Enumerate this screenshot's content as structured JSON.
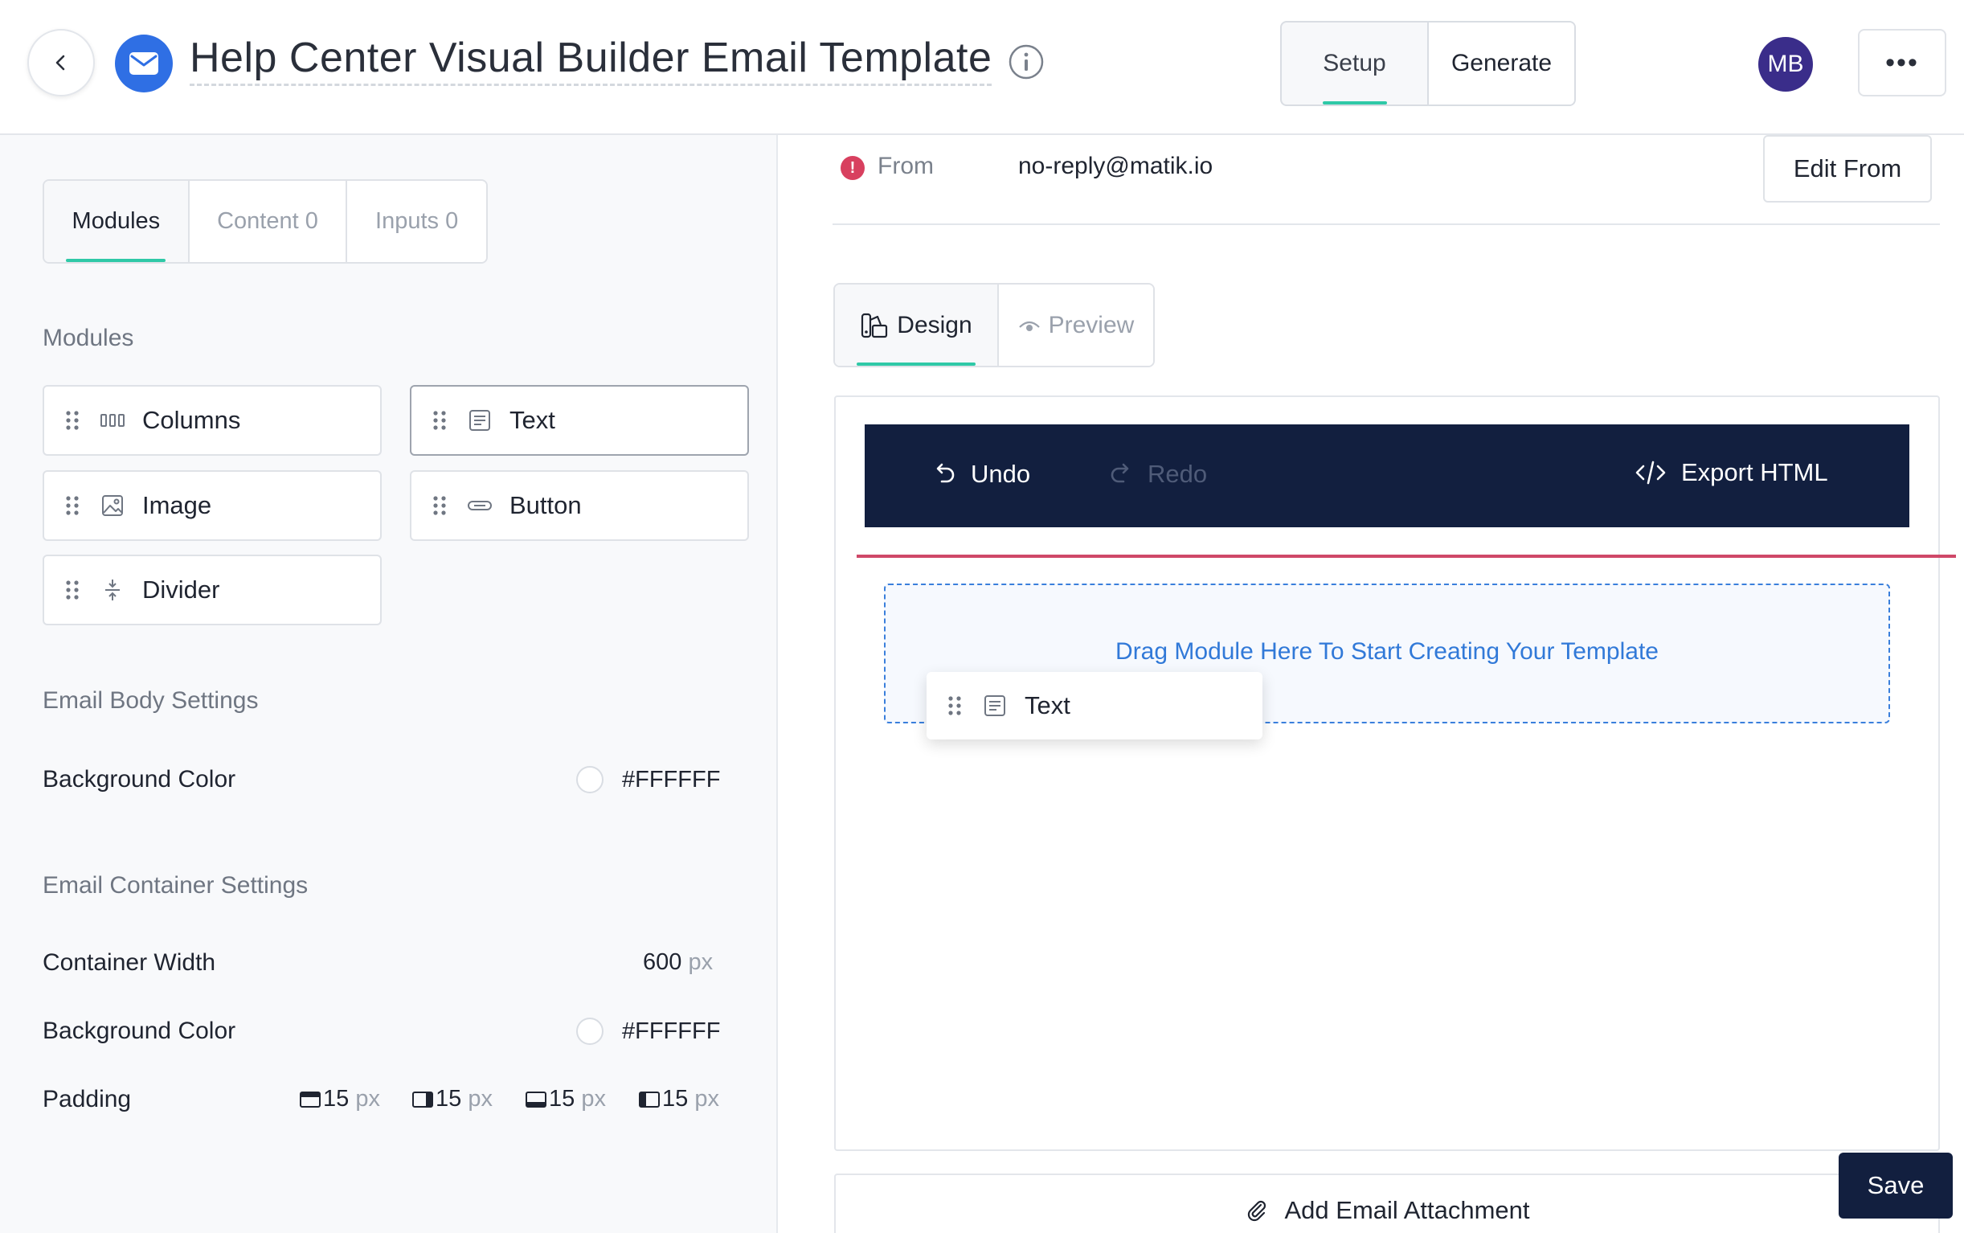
{
  "header": {
    "title": "Help Center Visual Builder Email Template",
    "setup_label": "Setup",
    "generate_label": "Generate",
    "avatar_initials": "MB",
    "more_label": "•••"
  },
  "left": {
    "tabs": [
      {
        "label": "Modules"
      },
      {
        "label": "Content 0"
      },
      {
        "label": "Inputs 0"
      }
    ],
    "modules_heading": "Modules",
    "modules": [
      {
        "label": "Columns",
        "icon": "columns-icon"
      },
      {
        "label": "Text",
        "icon": "text-icon"
      },
      {
        "label": "Image",
        "icon": "image-icon"
      },
      {
        "label": "Button",
        "icon": "button-icon"
      },
      {
        "label": "Divider",
        "icon": "divider-icon"
      }
    ],
    "email_body_heading": "Email Body Settings",
    "body_background_label": "Background Color",
    "body_background_value": "#FFFFFF",
    "email_container_heading": "Email Container Settings",
    "container_width_label": "Container Width",
    "container_width_value": "600",
    "unit_px": "px",
    "container_background_label": "Background Color",
    "container_background_value": "#FFFFFF",
    "padding_label": "Padding",
    "padding": [
      {
        "side": "top",
        "value": "15"
      },
      {
        "side": "right",
        "value": "15"
      },
      {
        "side": "bottom",
        "value": "15"
      },
      {
        "side": "left",
        "value": "15"
      }
    ]
  },
  "right": {
    "from_label": "From",
    "from_value": "no-reply@matik.io",
    "edit_from_label": "Edit From",
    "tabs": [
      {
        "label": "Design"
      },
      {
        "label": "Preview"
      }
    ],
    "undo_label": "Undo",
    "redo_label": "Redo",
    "export_label": "Export HTML",
    "drop_text": "Drag Module Here To Start Creating Your Template",
    "drag_ghost_label": "Text",
    "attach_label": "Add Email Attachment",
    "save_label": "Save"
  },
  "colors": {
    "accent": "#2fc9a7",
    "navy": "#121f3f",
    "brand_blue": "#2f6fe4",
    "error_red": "#d8405f",
    "drop_blue": "#3179d8",
    "avatar": "#3a2d8a"
  }
}
